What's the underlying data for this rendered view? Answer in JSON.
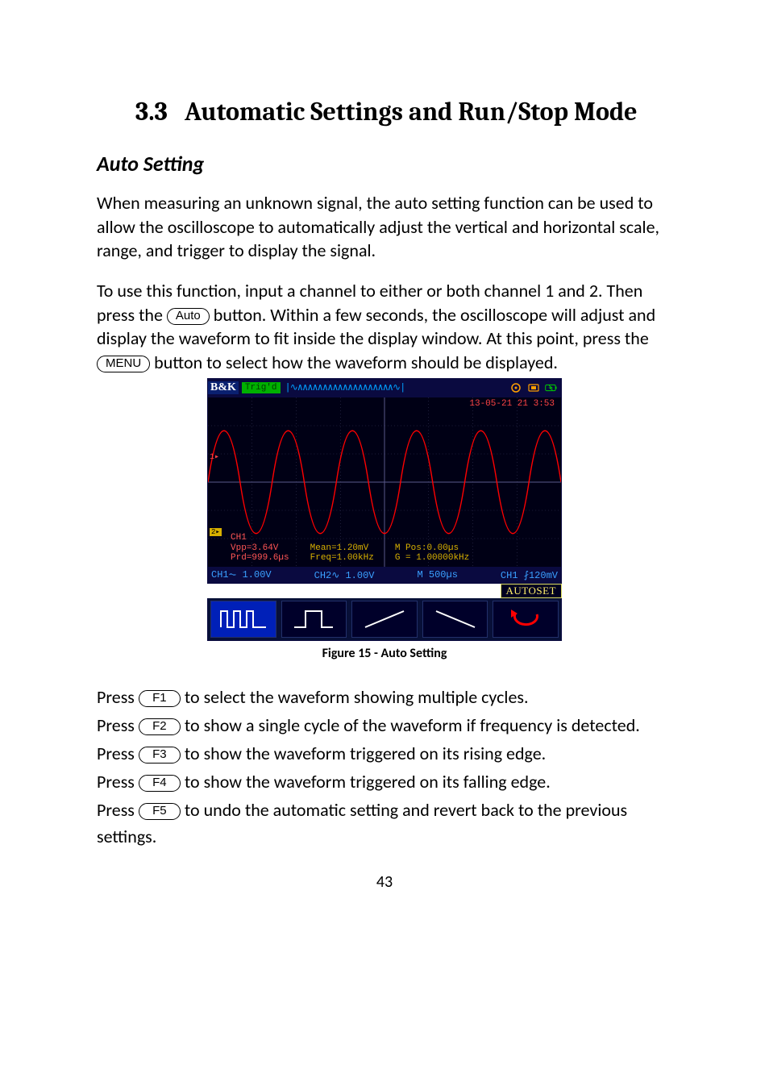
{
  "section": {
    "number": "3.3",
    "title": "Automatic Settings and Run/Stop Mode"
  },
  "subhead": "Auto Setting",
  "para1": "When measuring an unknown signal, the auto setting function can be used to allow the oscilloscope to automatically adjust the vertical and horizontal scale, range, and trigger to display the signal.",
  "para2_a": "To use this function, input a channel to either or both channel 1 and 2. Then press the ",
  "para2_b": " button.  Within a few seconds, the oscilloscope will adjust and display the waveform to fit inside the display window.  At this point, press the ",
  "para2_c": " button to select how the waveform should be displayed.",
  "keys": {
    "auto": "Auto",
    "menu": "MENU",
    "f1": "F1",
    "f2": "F2",
    "f3": "F3",
    "f4": "F4",
    "f5": "F5"
  },
  "scope": {
    "brand": "B&K",
    "trig_status": "Trig'd",
    "timestamp": "13-05-21 21 3:53",
    "ch1_label": "CH1",
    "vpp": "Vpp=3.64V",
    "prd": "Prd=999.6µs",
    "mean": "Mean=1.20mV",
    "freq": "Freq=1.00kHz",
    "mpos": "M Pos:0.00µs",
    "gfreq": "G = 1.00000kHz",
    "status_ch1": "CH1⏦ 1.00V",
    "status_ch2": "CH2∿ 1.00V",
    "status_m": "M 500µs",
    "status_trig": "CH1 ⨏120mV",
    "autoset": "AUTOSET"
  },
  "caption": "Figure 15 - Auto Setting",
  "press": {
    "pre": "Press ",
    "f1": " to select the waveform showing multiple cycles.",
    "f2": " to show a single cycle of the waveform if frequency is detected.",
    "f3": " to show the waveform triggered on its rising edge.",
    "f4": " to show the waveform triggered on its falling edge.",
    "f5": " to undo the automatic setting and revert back to the previous settings."
  },
  "page_number": "43"
}
